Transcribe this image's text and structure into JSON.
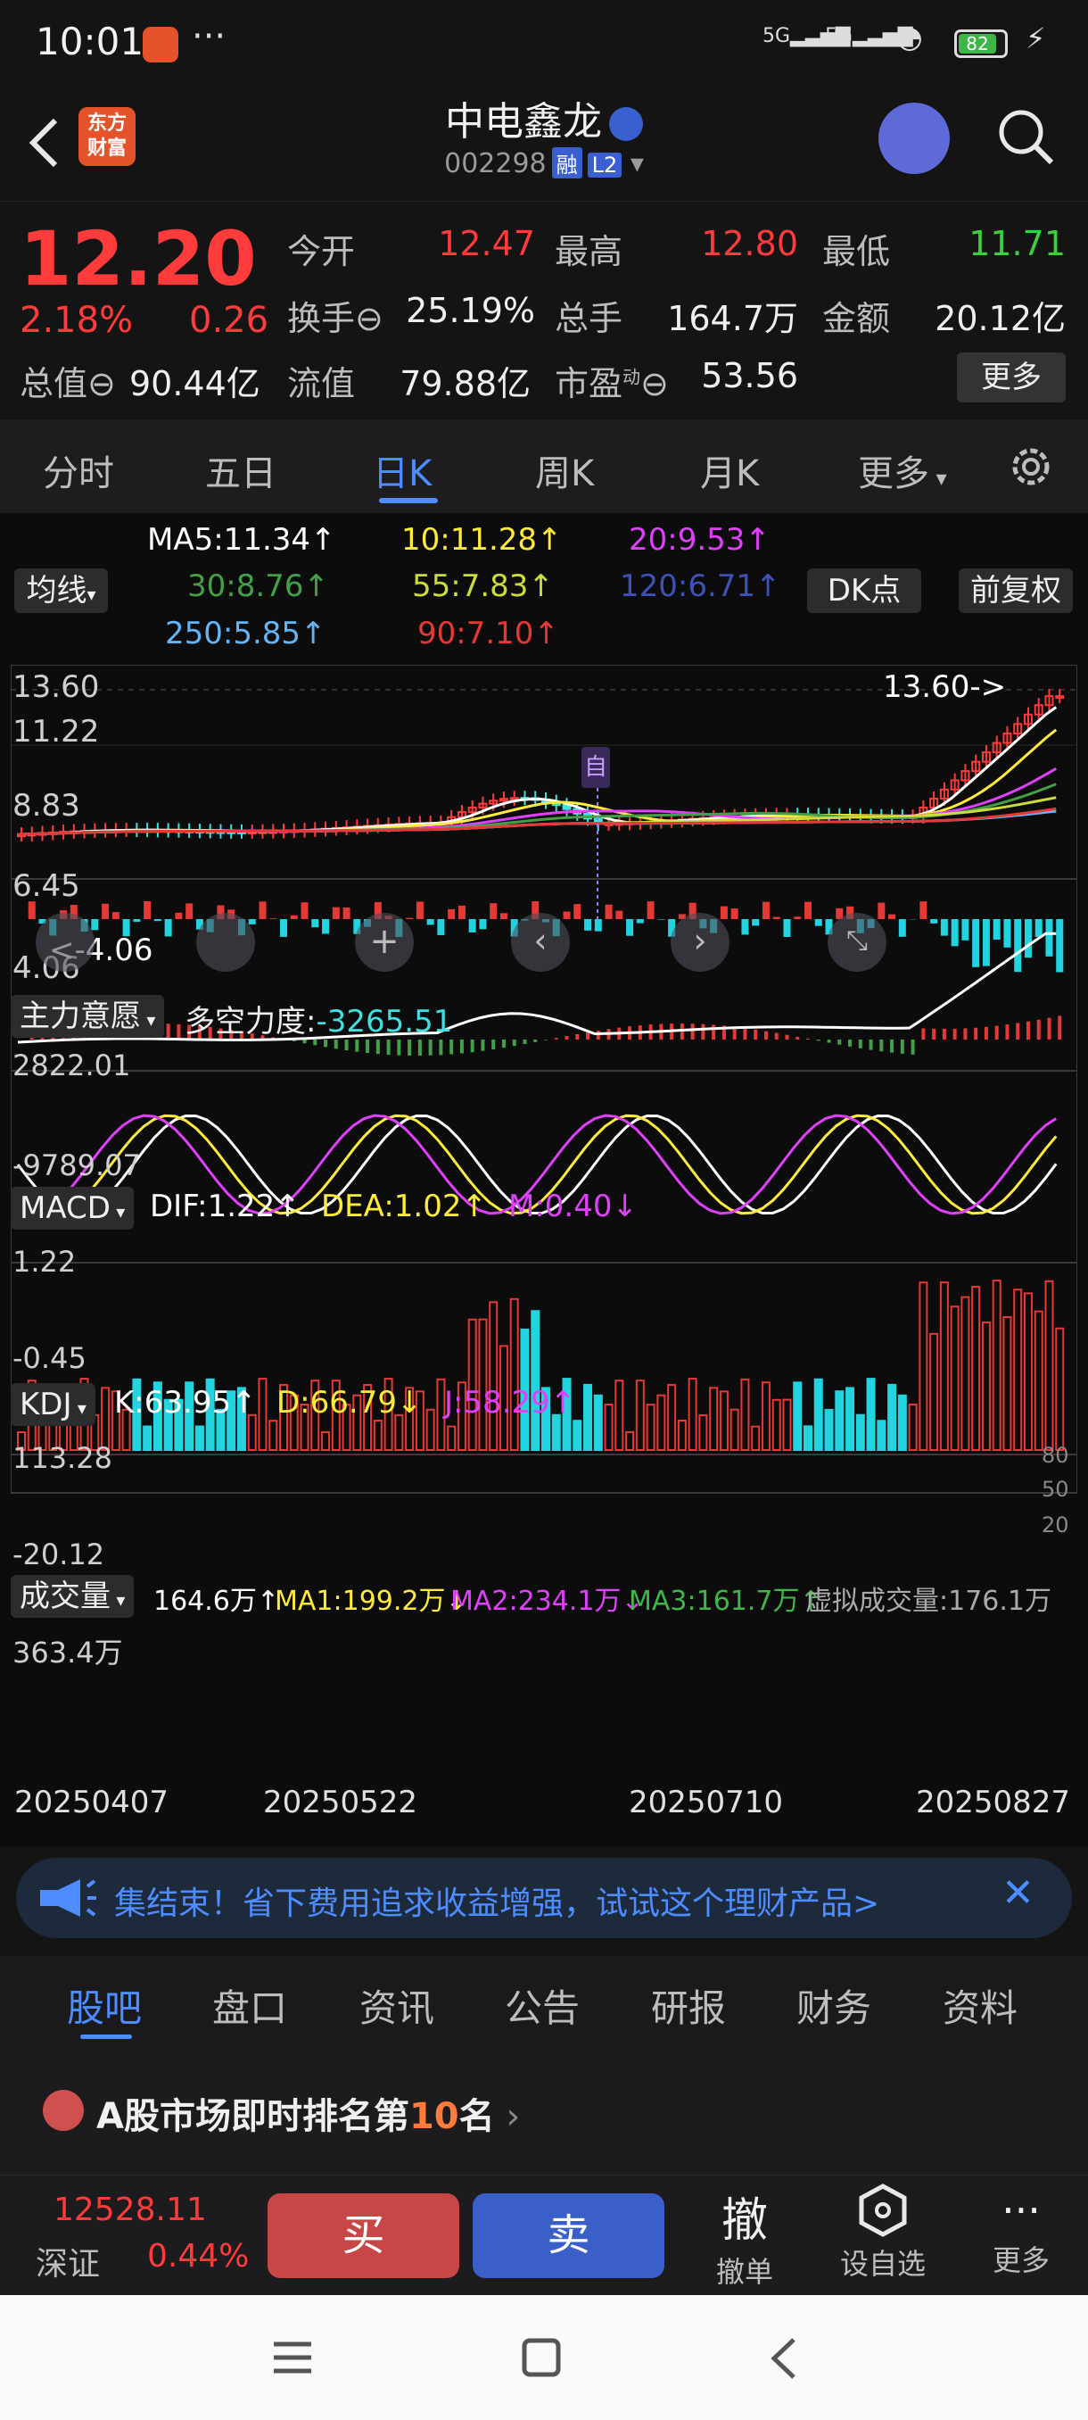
{
  "status_bar": {
    "time": "10:01",
    "battery": "82",
    "net1": "5G",
    "net2": "5G"
  },
  "header": {
    "logo_text": "东方财富",
    "name": "中电鑫龙",
    "code": "002298",
    "tag1": "融",
    "tag2": "L2"
  },
  "quote": {
    "price": "12.20",
    "change_pct": "2.18%",
    "change": "0.26",
    "open_label": "今开",
    "open": "12.47",
    "high_label": "最高",
    "high": "12.80",
    "low_label": "最低",
    "low": "11.71",
    "turnover_label": "换手",
    "turnover": "25.19%",
    "volume_label": "总手",
    "volume": "164.7万",
    "amount_label": "金额",
    "amount": "20.12亿",
    "mcap_label": "总值",
    "mcap": "90.44亿",
    "float_label": "流值",
    "float_mcap": "79.88亿",
    "pe_label": "市盈",
    "pe_sup": "动",
    "pe": "53.56",
    "more": "更多"
  },
  "k_tabs": [
    "分时",
    "五日",
    "日K",
    "周K",
    "月K",
    "更多"
  ],
  "chart": {
    "ma_button": "均线",
    "dk_button": "DK点",
    "fq_button": "前复权",
    "ma_labels": [
      "MA5:11.34↑",
      "10:11.28↑",
      "20:9.53↑",
      "30:8.76↑",
      "55:7.83↑",
      "120:6.71↑",
      "250:5.85↑",
      "90:7.10↑"
    ],
    "ma_colors": [
      "#ffffff",
      "#ffeb3b",
      "#e040fb",
      "#43a047",
      "#cddc39",
      "#3f51b5",
      "#64b5f6",
      "#e53935"
    ],
    "price_axis": [
      "13.60",
      "11.22",
      "8.83",
      "6.45",
      "4.06"
    ],
    "max_marker": "13.60->",
    "min_marker": "<-4.06",
    "self_marker": "自",
    "flow_button": "主力意愿",
    "flow_label": "多空力度:",
    "flow_value": "-3265.51",
    "flow_axis": [
      "2822.01",
      "-9789.07"
    ],
    "macd_button": "MACD",
    "macd_dif": "DIF:1.22↑",
    "macd_dea": "DEA:1.02↑",
    "macd_m": "M:0.40↓",
    "macd_axis": [
      "1.22",
      "-0.45"
    ],
    "kdj_button": "KDJ",
    "kdj_k": "K:63.95↑",
    "kdj_d": "D:66.79↓",
    "kdj_j": "J:58.29↑",
    "kdj_axis": [
      "113.28",
      "-20.12"
    ],
    "kdj_right_axis": [
      "80",
      "50",
      "20"
    ],
    "vol_button": "成交量",
    "vol_val": "164.6万↑",
    "vol_ma1": "MA1:199.2万↓",
    "vol_ma2": "MA2:234.1万↓",
    "vol_ma3": "MA3:161.7万↑",
    "vol_virtual": "虚拟成交量:176.1万",
    "vol_axis": "363.4万",
    "dates": [
      "20250407",
      "20250522",
      "20250710",
      "20250827"
    ]
  },
  "banner": {
    "text": "集结束！省下费用追求收益增强，试试这个理财产品>"
  },
  "bottom_tabs": [
    "股吧",
    "盘口",
    "资讯",
    "公告",
    "研报",
    "财务",
    "资料"
  ],
  "ranking": {
    "prefix": "A股市场即时排名第",
    "rank": "10",
    "suffix": "名"
  },
  "trade": {
    "index_value": "12528.11",
    "index_name": "深证",
    "index_pct": "0.44%",
    "buy": "买",
    "sell": "卖",
    "cancel_icon_char": "撤",
    "cancel": "撤单",
    "watch": "设自选",
    "more": "更多"
  }
}
